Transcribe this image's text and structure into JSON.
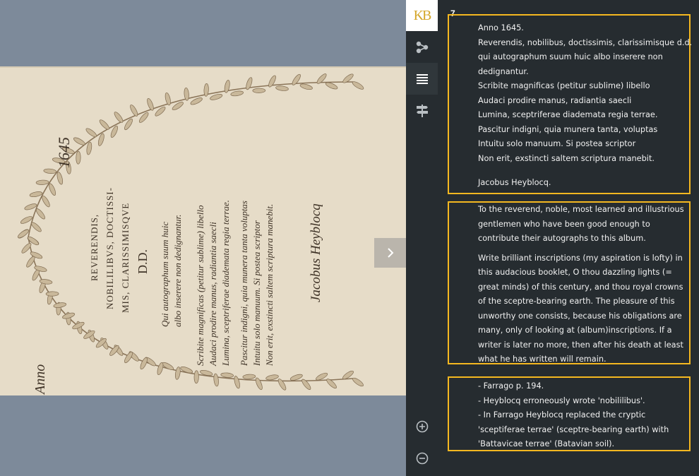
{
  "viewer": {
    "next_label": "›",
    "handwriting": {
      "year": "1645",
      "anno": "Anno",
      "heading": [
        "REVERENDIS,",
        "NOBILILIBVS, DOCTISSI-",
        "MIS, CLARISSIMISQVE",
        "D.D."
      ],
      "signature": "Jacobus Heyblocq"
    }
  },
  "toolbar": {
    "logo": "KB",
    "tools": [
      {
        "name": "share-tool",
        "icon": "share-icon"
      },
      {
        "name": "text-tool",
        "icon": "text-lines-icon"
      },
      {
        "name": "signpost-tool",
        "icon": "signpost-icon"
      }
    ],
    "bottom": [
      {
        "name": "zoom-in-button",
        "icon": "zoom-in-icon"
      },
      {
        "name": "zoom-out-button",
        "icon": "zoom-out-icon"
      }
    ]
  },
  "panel": {
    "page_number": "7",
    "transcription": [
      "Anno 1645.",
      "Reverendis, nobilibus, doctissimis, clarissimisque d.d.",
      "qui autographum suum huic albo inserere non",
      "dedignantur.",
      "Scribite magnificas (petitur sublime) libello",
      "Audaci prodire manus, radiantia saecli",
      "Lumina, sceptriferae diademata regia terrae.",
      "Pascitur indigni, quia munera tanta, voluptas",
      "Intuitu solo manuum. Si postea scriptor",
      "Non erit, exstincti saltem scriptura manebit."
    ],
    "signature": "Jacobus Heyblocq.",
    "translation": [
      "To the reverend, noble, most learned and illustrious gentlemen who have been good enough to contribute their autographs to this album.",
      "Write brilliant inscriptions (my aspiration is lofty) in this audacious booklet, O thou dazzling lights (= great minds) of this century, and thou royal crowns of the sceptre-bearing earth. The pleasure of this unworthy one consists, because his obligations are many, only of looking at (album)inscriptions. If a writer is later no more, then after his death at least what he has written will remain."
    ],
    "notes": [
      "- Farrago p. 194.",
      "- Heyblocq erroneously wrote 'nobililibus'.",
      "- In Farrago Heyblocq replaced the cryptic 'sceptiferae terrae' (sceptre-bearing earth) with 'Battavicae terrae' (Batavian soil)."
    ]
  },
  "colors": {
    "accent": "#f5b820",
    "panel_bg": "#262c30",
    "logo": "#d4a62a"
  }
}
